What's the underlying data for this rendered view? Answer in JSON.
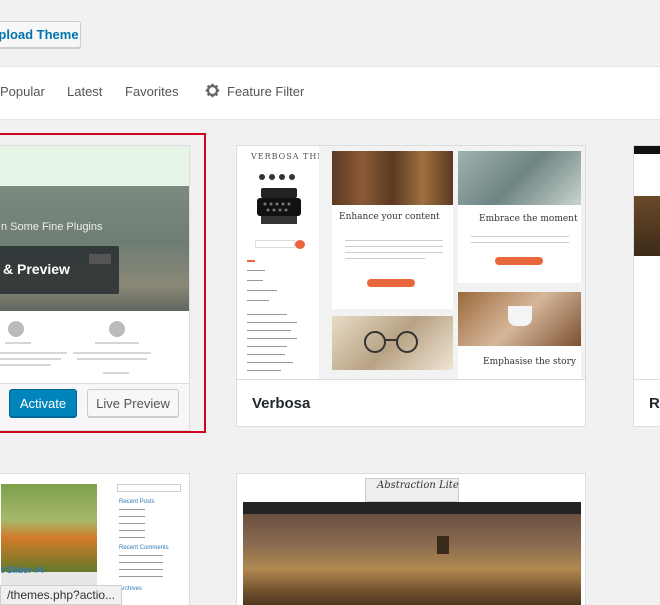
{
  "header": {
    "upload_label": "Upload Theme"
  },
  "filter_bar": {
    "popular": "Popular",
    "latest": "Latest",
    "favorites": "Favorites",
    "feature_filter": "Feature Filter"
  },
  "themes": {
    "active": {
      "slider_text": "n Some Fine Plugins",
      "overlay_label": "& Preview",
      "activate_label": "Activate",
      "live_preview_label": "Live Preview"
    },
    "verbosa": {
      "name": "Verbosa",
      "brand": "VERBOSA THEME",
      "post1": "Enhance your content",
      "post2": "Embrace the moment",
      "post3": "Emphasise the story"
    },
    "partial_right": {
      "name": "Re"
    },
    "bottom_left": {
      "slider_caption": "t Slider #4",
      "sidebar_recent_posts": "Recent Posts",
      "sidebar_recent_comments": "Recent Comments",
      "sidebar_archives": "Archives"
    },
    "abstraction": {
      "title": "Abstraction Lite"
    }
  },
  "status_url": "/themes.php?actio..."
}
